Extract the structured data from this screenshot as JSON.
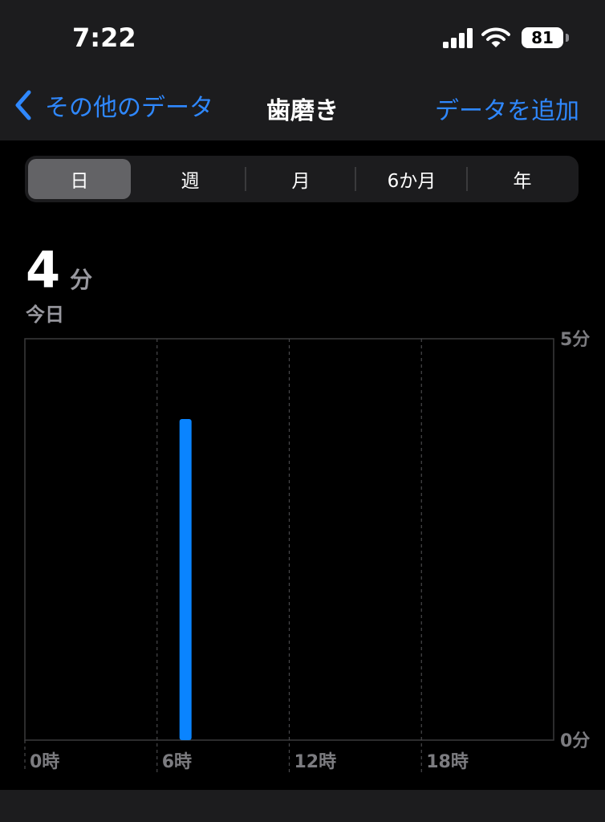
{
  "status_bar": {
    "time": "7:22",
    "battery_level": "81",
    "icons": [
      "signal-icon",
      "wifi-icon",
      "battery-icon"
    ]
  },
  "nav": {
    "back_label": "その他のデータ",
    "back_icon": "chevron-left-icon",
    "title": "歯磨き",
    "action_label": "データを追加"
  },
  "segments": [
    "日",
    "週",
    "月",
    "6か月",
    "年"
  ],
  "selected_segment": "日",
  "summary": {
    "value": "4",
    "unit": "分",
    "period": "今日"
  },
  "colors": {
    "accent": "#2f88ff",
    "bar": "#0a84ff",
    "background": "#000000",
    "panel": "#1c1c1e",
    "secondary_text": "#98989f"
  },
  "chart_data": {
    "type": "bar",
    "x_ticks": [
      "0時",
      "6時",
      "12時",
      "18時"
    ],
    "y_ticks": [
      "5分",
      "0分"
    ],
    "ylim": [
      0,
      5
    ],
    "xlim": [
      0,
      24
    ],
    "series": [
      {
        "x": [
          7
        ],
        "values": [
          4
        ]
      }
    ],
    "grid": true
  }
}
